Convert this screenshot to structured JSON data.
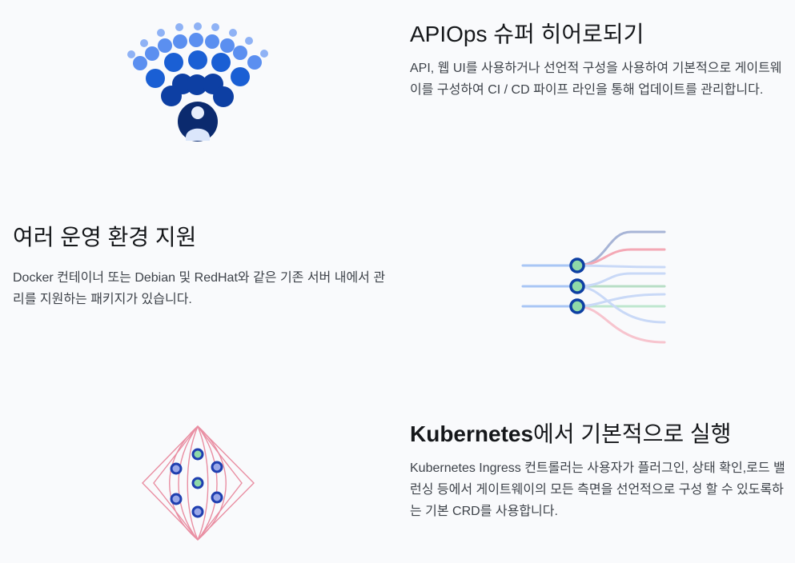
{
  "features": [
    {
      "title": "APIOps 슈퍼 히어로되기",
      "description": "API, 웹 UI를 사용하거나 선언적 구성을 사용하여 기본적으로 게이트웨이를 구성하여 CI / CD 파이프 라인을 통해 업데이트를 관리합니다.",
      "illustration_icon": "hero-crowd-icon"
    },
    {
      "title": "여러 운영 환경 지원",
      "description": "Docker 컨테이너 또는 Debian 및 RedHat와 같은 기존 서버 내에서 관리를 지원하는 패키지가 있습니다.",
      "illustration_icon": "traffic-routing-icon"
    },
    {
      "title_strong": "Kubernetes",
      "title_rest": "에서 기본적으로 실행",
      "description": "Kubernetes Ingress 컨트롤러는 사용자가 플러그인, 상태 확인,로드 밸런싱 등에서 게이트웨이의 모든 측면을 선언적으로 구성 할 수 있도록하는 기본 CRD를 사용합니다.",
      "illustration_icon": "kubernetes-mesh-icon"
    }
  ],
  "colors": {
    "background": "#f9fafc",
    "navy": "#0b2a6e",
    "blue_dark": "#0d3fa3",
    "blue": "#1a5fd4",
    "blue_light": "#8fb2f5",
    "green": "#8fd9a8",
    "pink": "#f2a7b6",
    "mesh_pink": "#e98ea2"
  }
}
